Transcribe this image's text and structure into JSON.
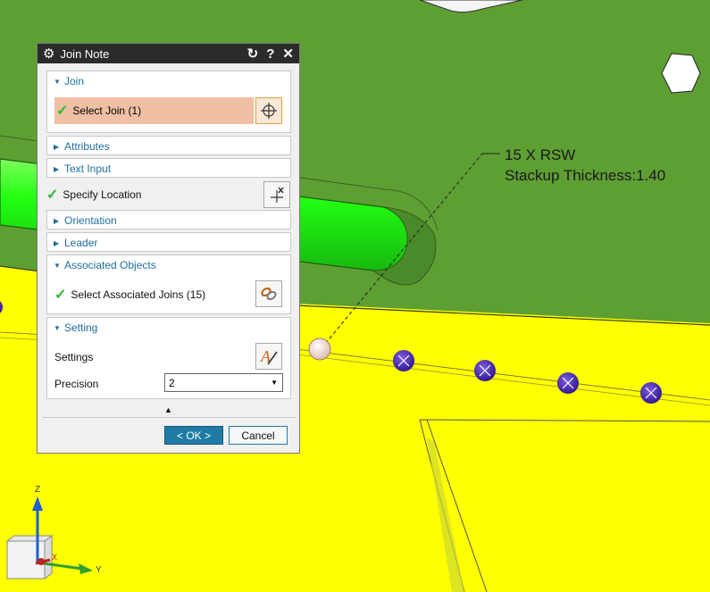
{
  "annotation": {
    "line1": "15 X RSW",
    "line2": "Stackup Thickness:1.40"
  },
  "triad": {
    "z_label": "Z",
    "y_label": "Y",
    "x_label": "X"
  },
  "dialog": {
    "title": "Join Note",
    "title_icon": "gear-icon",
    "buttons": {
      "reset": "↻",
      "help": "?",
      "close": "✕"
    },
    "groups": {
      "join": {
        "label": "Join",
        "expanded": true,
        "select_label": "Select Join (1)",
        "select_icon": "crosshair-icon"
      },
      "attributes": {
        "label": "Attributes",
        "expanded": false
      },
      "text_input": {
        "label": "Text Input",
        "expanded": false
      },
      "specify_location": {
        "label": "Specify Location",
        "icon": "location-point-icon"
      },
      "orientation": {
        "label": "Orientation",
        "expanded": false
      },
      "leader": {
        "label": "Leader",
        "expanded": false
      },
      "associated_objects": {
        "label": "Associated Objects",
        "expanded": true,
        "select_label": "Select Associated Joins (15)",
        "select_icon": "chain-link-icon"
      },
      "setting": {
        "label": "Setting",
        "expanded": true,
        "settings_label": "Settings",
        "settings_icon": "text-style-icon",
        "precision_label": "Precision",
        "precision_value": "2"
      }
    },
    "ok_label": "< OK >",
    "cancel_label": "Cancel"
  },
  "colors": {
    "background_green": "#5e9f33",
    "background_yellow": "#ffff00",
    "selection_highlight": "#efc0a4",
    "ok_button": "#1f7ba3",
    "check_green": "#2db82d",
    "weld_point": "#4b2aa0"
  }
}
